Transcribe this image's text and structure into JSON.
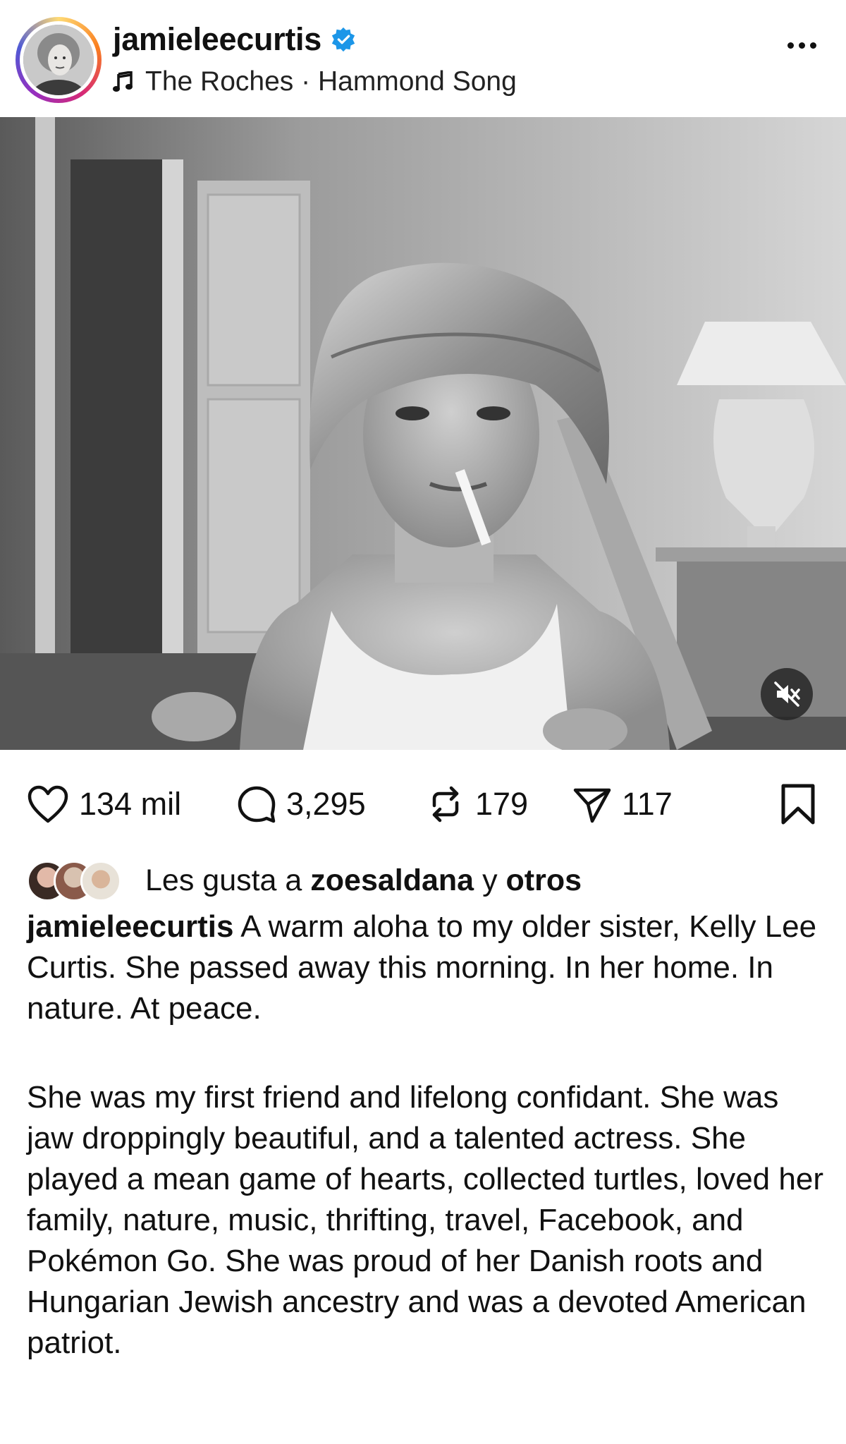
{
  "post": {
    "username": "jamieleecurtis",
    "verified": true,
    "music_artist": "The Roches",
    "music_separator": "·",
    "music_track": "Hammond Song",
    "more_icon": "more-horizontal-icon"
  },
  "media": {
    "type": "video",
    "description_icon": "mute-icon"
  },
  "actions": {
    "likes_count": "134 mil",
    "comments_count": "3,295",
    "reposts_count": "179",
    "shares_count": "117"
  },
  "liked_by": {
    "prefix": "Les gusta a",
    "user": "zoesaldana",
    "connector": "y",
    "others": "otros"
  },
  "caption": {
    "author": "jamieleecurtis",
    "paragraph1": "A warm aloha to my older sister, Kelly Lee Curtis. She passed away this morning. In her home. In nature. At peace.",
    "paragraph2": "She was my first friend and lifelong confidant. She was jaw droppingly beautiful, and a talented actress. She played a mean game of hearts, collected turtles, loved her family, nature, music, thrifting, travel, Facebook, and Pokémon Go. She was proud of her Danish roots and Hungarian Jewish ancestry and was a devoted American patriot."
  },
  "colors": {
    "verified_blue": "#1c96e8",
    "text": "#111111",
    "mute_bg": "#262626"
  }
}
